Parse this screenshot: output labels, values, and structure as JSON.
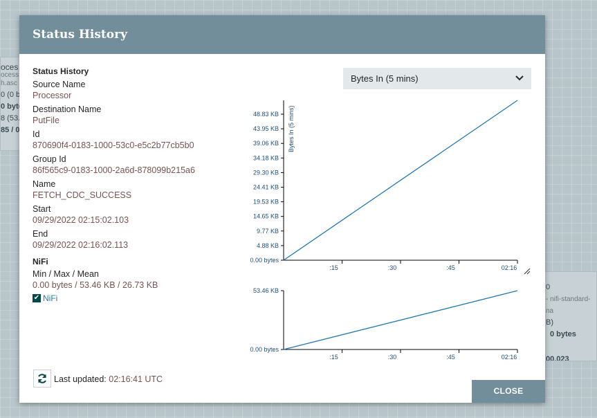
{
  "dialog": {
    "title": "Status History",
    "details": {
      "section_title": "Status History",
      "source_name_label": "Source Name",
      "source_name": "Processor",
      "destination_name_label": "Destination Name",
      "destination_name": "PutFile",
      "id_label": "Id",
      "id": "870690f4-0183-1000-53c0-e5c2b77cb5b0",
      "group_id_label": "Group Id",
      "group_id": "86f565c9-0183-1000-2a6d-878099b215a6",
      "name_label": "Name",
      "name": "FETCH_CDC_SUCCESS",
      "start_label": "Start",
      "start": "09/29/2022 02:15:02.103",
      "end_label": "End",
      "end": "09/29/2022 02:16:02.113",
      "nifi_section": "NiFi",
      "min_max_mean_label": "Min / Max / Mean",
      "min_max_mean": "0.00 bytes / 53.46 KB / 26.73 KB",
      "checkbox_label": "NiFi",
      "checkbox_checked": true
    },
    "metric_select": {
      "value": "Bytes In (5 mins)"
    },
    "footer": {
      "last_updated_label": "Last updated:",
      "last_updated_time": "02:16:41 UTC",
      "close_label": "CLOSE"
    }
  },
  "background_cards": {
    "left": [
      "oces",
      "ocess",
      "h.asc",
      "0 (0 b",
      "0 byte",
      "8 (53.",
      "85 / 0"
    ],
    "right": [
      "0",
      "- nifi-standard-na",
      "B)",
      "0 bytes",
      "00.023"
    ]
  },
  "chart_data": [
    {
      "type": "line",
      "ylabel": "Bytes In (5 mins)",
      "x_tick_labels": [
        ":15",
        ":30",
        ":45",
        "02:16"
      ],
      "y_tick_labels": [
        "0.00 bytes",
        "4.88 KB",
        "9.77 KB",
        "14.65 KB",
        "19.53 KB",
        "24.41 KB",
        "29.30 KB",
        "34.18 KB",
        "39.06 KB",
        "43.95 KB",
        "48.83 KB"
      ],
      "y_tick_values": [
        0,
        4.88,
        9.77,
        14.65,
        19.53,
        24.41,
        29.3,
        34.18,
        39.06,
        43.95,
        48.83
      ],
      "x_tick_values": [
        15,
        30,
        45,
        60
      ],
      "ylim": [
        0,
        53.46
      ],
      "xlim": [
        0,
        60
      ],
      "series": [
        {
          "x": [
            0,
            60
          ],
          "y": [
            0,
            53.46
          ]
        }
      ]
    },
    {
      "type": "line",
      "x_tick_labels": [
        ":15",
        ":30",
        ":45",
        "02:16"
      ],
      "y_tick_labels": [
        "0.00 bytes",
        "53.46 KB"
      ],
      "y_tick_values": [
        0,
        53.46
      ],
      "x_tick_values": [
        15,
        30,
        45,
        60
      ],
      "ylim": [
        0,
        53.46
      ],
      "xlim": [
        0,
        60
      ],
      "series": [
        {
          "x": [
            0,
            60
          ],
          "y": [
            0,
            53.46
          ]
        }
      ]
    }
  ],
  "colors": {
    "header": "#728e9b",
    "value_text": "#775351",
    "line": "#1f77b4",
    "checkbox": "#004849",
    "link": "#1b7fab"
  },
  "icons": {
    "select": "chevron-down-icon",
    "refresh": "refresh-icon",
    "check": "check-icon",
    "resize": "resize-handle-icon"
  }
}
